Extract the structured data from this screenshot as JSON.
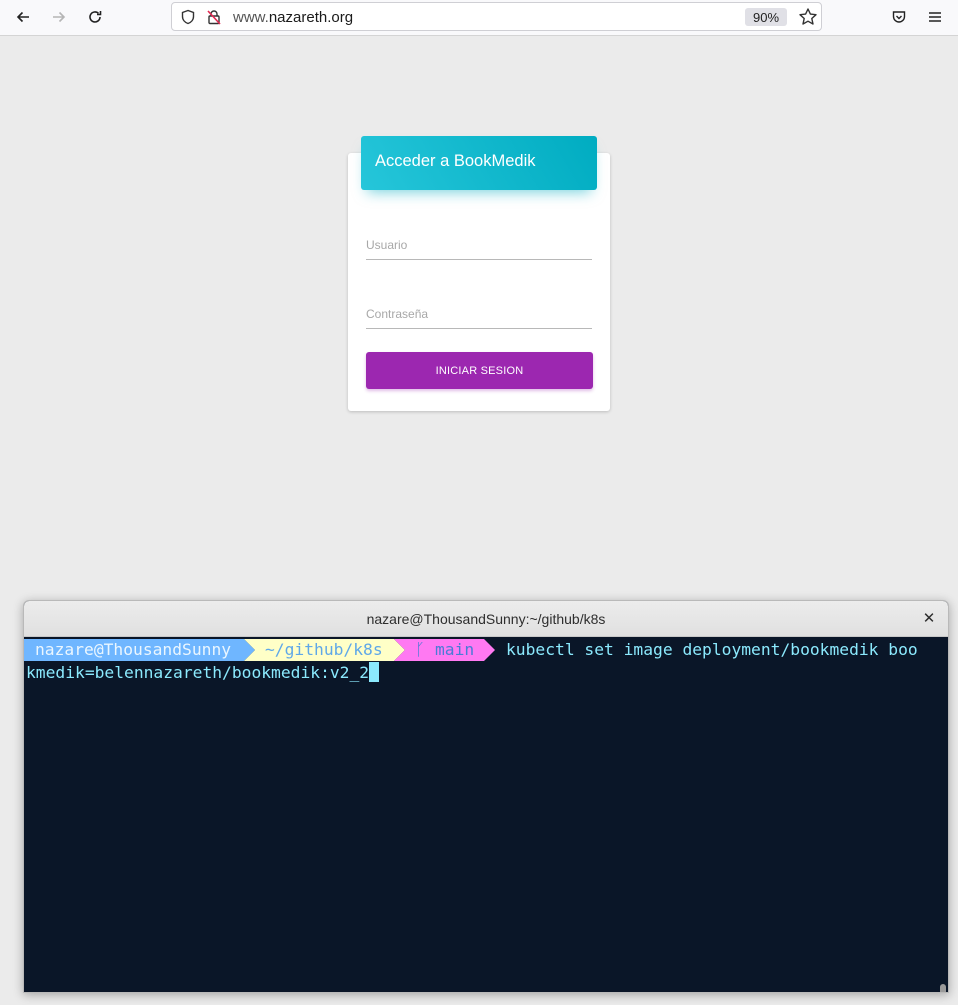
{
  "browser": {
    "url_prefix": "www.",
    "url_host": "nazareth.org",
    "zoom": "90%",
    "icons": [
      "back-arrow-icon",
      "forward-arrow-icon",
      "reload-icon",
      "shield-icon",
      "insecure-lock-icon",
      "bookmark-star-icon",
      "pocket-icon",
      "hamburger-menu-icon"
    ]
  },
  "login": {
    "header_title": "Acceder a BookMedik",
    "username_placeholder": "Usuario",
    "password_placeholder": "Contraseña",
    "submit_label": "INICIAR SESION",
    "colors": {
      "header": "#00acc1",
      "button": "#9c27b0"
    }
  },
  "terminal": {
    "title": "nazare@ThousandSunny:~/github/k8s",
    "prompt_user": "nazare@ThousandSunny",
    "prompt_dir": "~/github/k8s",
    "prompt_branch": "main",
    "command_line1": "kubectl set image deployment/bookmedik boo",
    "command_line2": "kmedik=belennazareth/bookmedik:v2_2",
    "colors": {
      "user_segment": "#6fb6ff",
      "dir_segment": "#ffffc7",
      "branch_segment": "#ff79f2",
      "command_text": "#8be9fd",
      "background": "#0a1628"
    }
  }
}
